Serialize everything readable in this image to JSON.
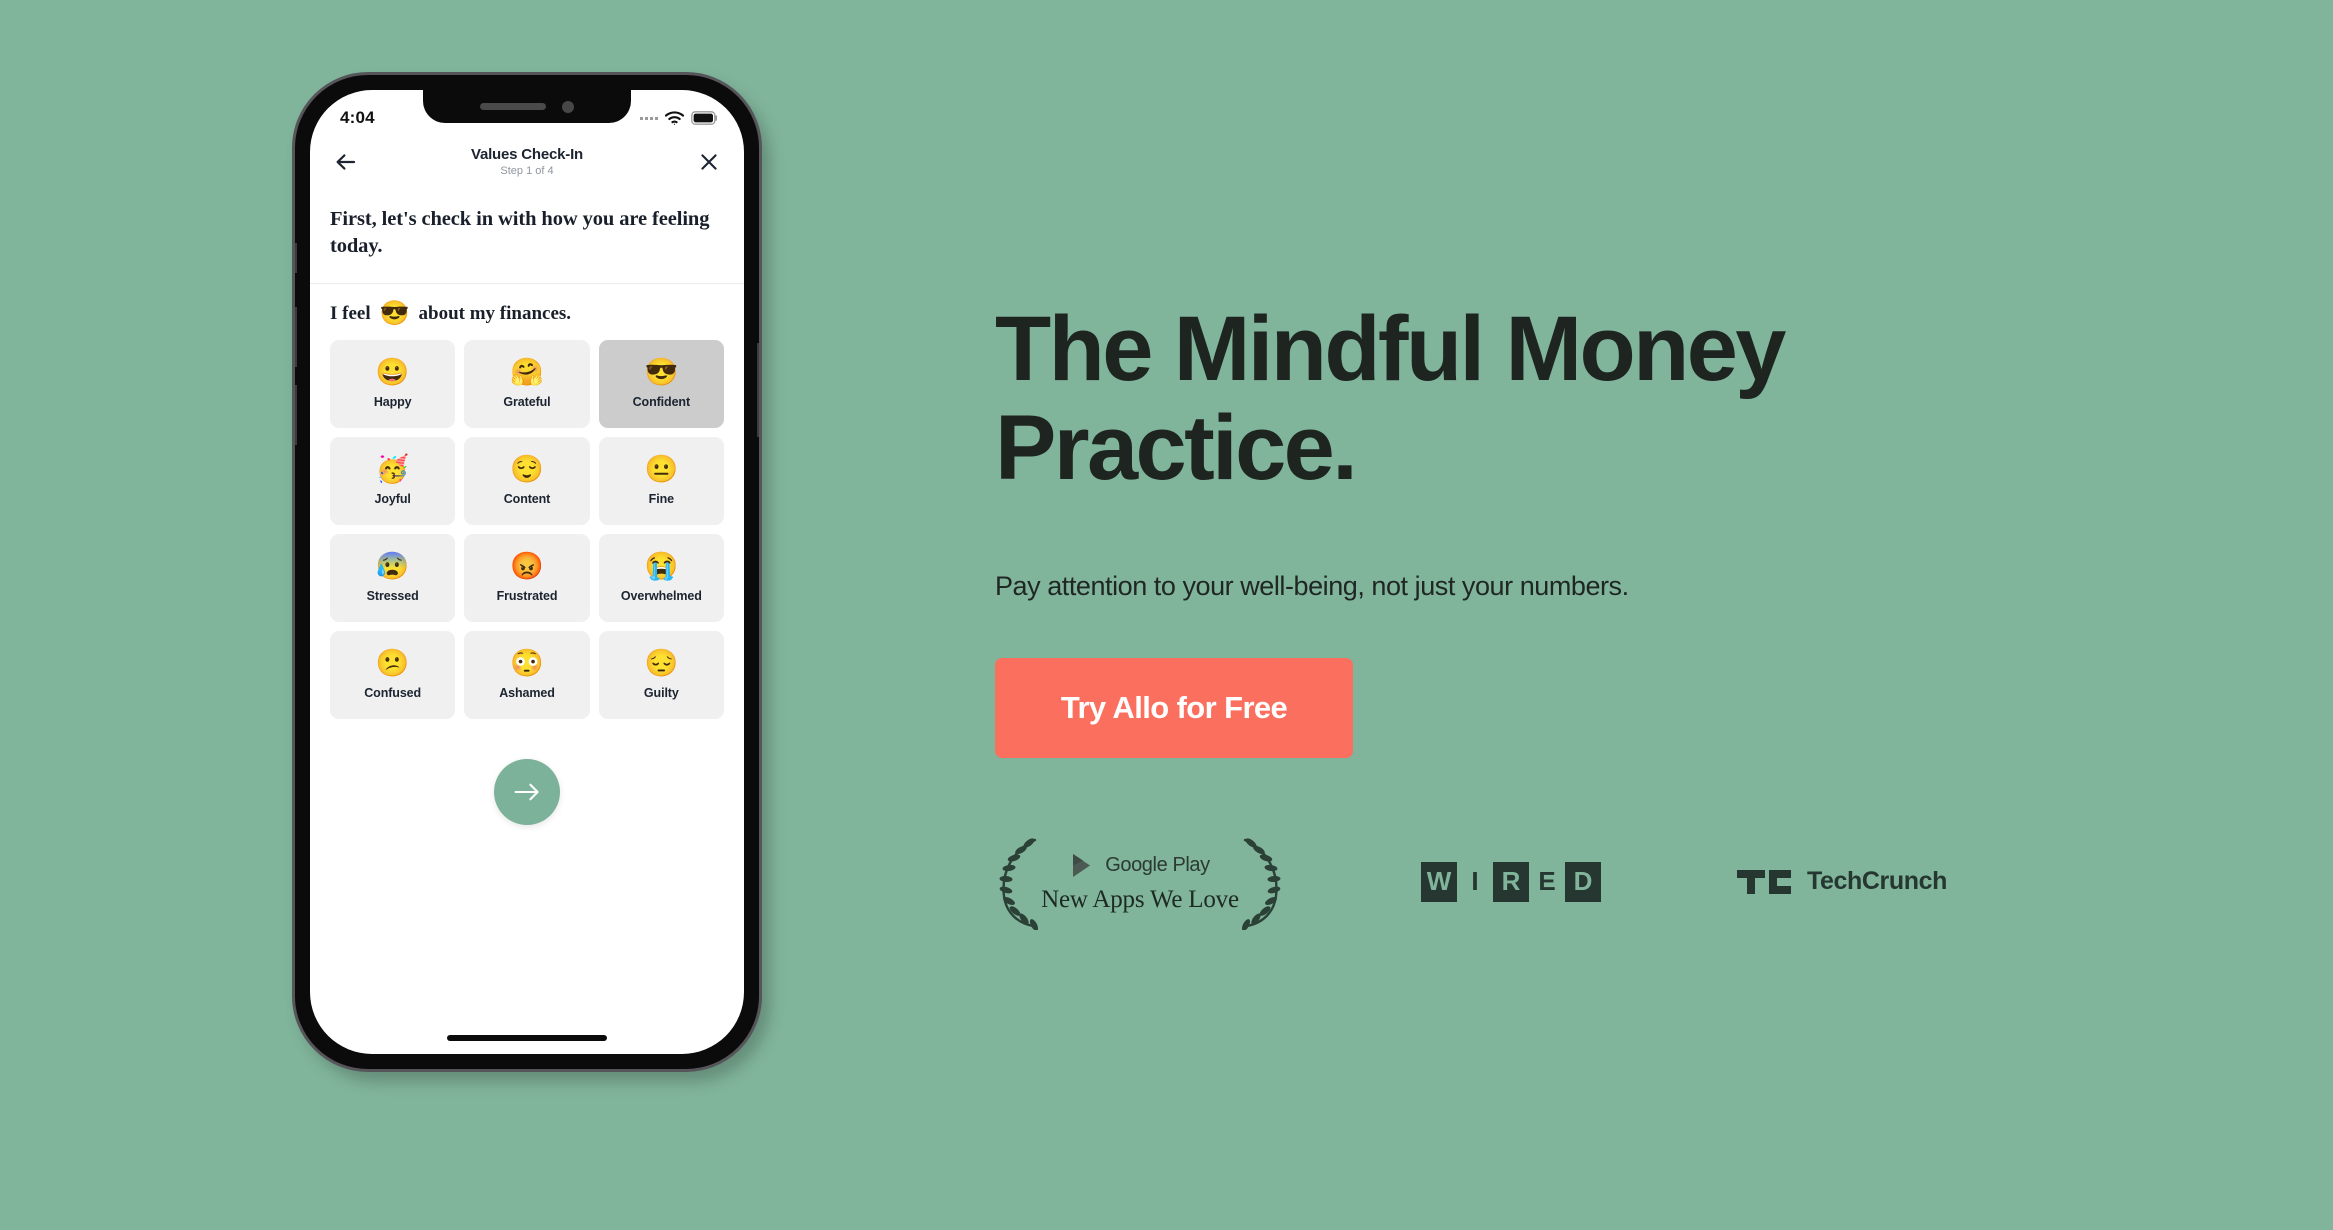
{
  "page": {
    "background_color": "#80b49b"
  },
  "phone": {
    "status_bar": {
      "time": "4:04",
      "signal_icon": "signal-dots-icon",
      "wifi_icon": "wifi-icon",
      "battery_icon": "battery-icon"
    },
    "hardware": {
      "mute_switch": "mute-switch",
      "volume_up": "volume-up-button",
      "volume_down": "volume-down-button",
      "power": "power-button",
      "notch_speaker": "earpiece-speaker",
      "notch_camera": "front-camera"
    },
    "app_header": {
      "back_icon": "back-arrow-icon",
      "title": "Values Check-In",
      "subtitle": "Step 1 of 4",
      "close_icon": "close-x-icon"
    },
    "screen": {
      "prompt": "First, let's check in with how you are feeling today.",
      "sentence_prefix": "I feel",
      "sentence_emoji": "😎",
      "sentence_suffix": "about my finances.",
      "emotions": [
        {
          "emoji": "😀",
          "label": "Happy",
          "selected": false
        },
        {
          "emoji": "🤗",
          "label": "Grateful",
          "selected": false
        },
        {
          "emoji": "😎",
          "label": "Confident",
          "selected": true
        },
        {
          "emoji": "🥳",
          "label": "Joyful",
          "selected": false
        },
        {
          "emoji": "😌",
          "label": "Content",
          "selected": false
        },
        {
          "emoji": "😐",
          "label": "Fine",
          "selected": false
        },
        {
          "emoji": "😰",
          "label": "Stressed",
          "selected": false
        },
        {
          "emoji": "😡",
          "label": "Frustrated",
          "selected": false
        },
        {
          "emoji": "😭",
          "label": "Overwhelmed",
          "selected": false
        },
        {
          "emoji": "😕",
          "label": "Confused",
          "selected": false
        },
        {
          "emoji": "😳",
          "label": "Ashamed",
          "selected": false
        },
        {
          "emoji": "😔",
          "label": "Guilty",
          "selected": false
        }
      ],
      "next_button_icon": "arrow-right-icon",
      "next_button_color": "#7cb29a"
    }
  },
  "hero": {
    "title_line_1": "The Mindful Money",
    "title_line_2": "Practice.",
    "subtitle": "Pay attention to your well-being, not just your numbers.",
    "cta_label": "Try Allo for Free",
    "cta_color": "#fb6f5f",
    "text_color": "#1e2420"
  },
  "press": {
    "award": {
      "platform": "Google Play",
      "caption": "New Apps We Love",
      "play_icon": "google-play-triangle-icon",
      "laurel_icon": "laurel-wreath-icon"
    },
    "wired": {
      "name": "WIRED",
      "letters": [
        {
          "char": "W",
          "boxed": true
        },
        {
          "char": "I",
          "boxed": false
        },
        {
          "char": "R",
          "boxed": true
        },
        {
          "char": "E",
          "boxed": false
        },
        {
          "char": "D",
          "boxed": true
        }
      ]
    },
    "techcrunch": {
      "name": "TechCrunch",
      "mark": "tc-monogram-icon"
    }
  }
}
